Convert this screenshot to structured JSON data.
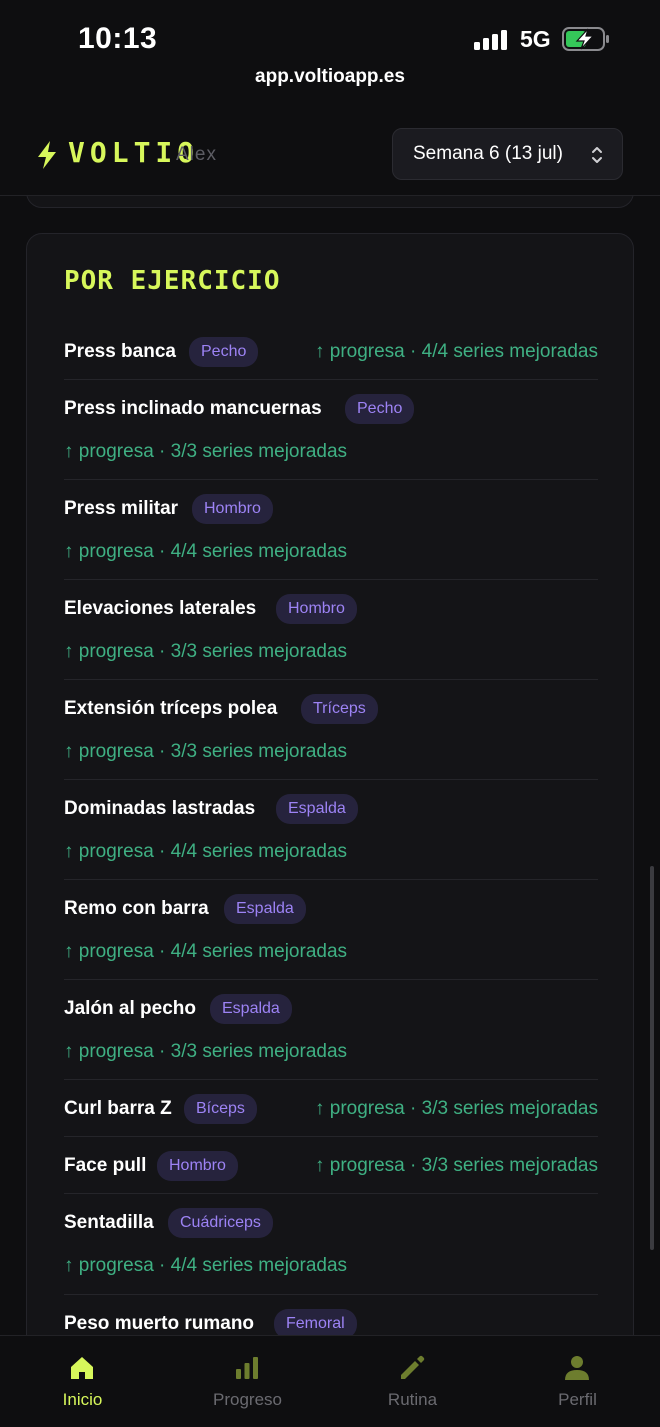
{
  "status_bar": {
    "time": "10:13",
    "network": "5G"
  },
  "browser": {
    "url": "app.voltioapp.es"
  },
  "header": {
    "brand": "VOLTIO",
    "user": "Alex",
    "week_select": "Semana 6 (13 jul)"
  },
  "section": {
    "title": "POR EJERCICIO",
    "exercises": [
      {
        "name": "Press banca",
        "muscle": "Pecho",
        "progress": "↑ progresa · 4/4 series mejoradas"
      },
      {
        "name": "Press inclinado mancuernas",
        "muscle": "Pecho",
        "progress": "↑ progresa · 3/3 series mejoradas"
      },
      {
        "name": "Press militar",
        "muscle": "Hombro",
        "progress": "↑ progresa · 4/4 series mejoradas"
      },
      {
        "name": "Elevaciones laterales",
        "muscle": "Hombro",
        "progress": "↑ progresa · 3/3 series mejoradas"
      },
      {
        "name": "Extensión tríceps polea",
        "muscle": "Tríceps",
        "progress": "↑ progresa · 3/3 series mejoradas"
      },
      {
        "name": "Dominadas lastradas",
        "muscle": "Espalda",
        "progress": "↑ progresa · 4/4 series mejoradas"
      },
      {
        "name": "Remo con barra",
        "muscle": "Espalda",
        "progress": "↑ progresa · 4/4 series mejoradas"
      },
      {
        "name": "Jalón al pecho",
        "muscle": "Espalda",
        "progress": "↑ progresa · 3/3 series mejoradas"
      },
      {
        "name": "Curl barra Z",
        "muscle": "Bíceps",
        "progress": "↑ progresa · 3/3 series mejoradas"
      },
      {
        "name": "Face pull",
        "muscle": "Hombro",
        "progress": "↑ progresa · 3/3 series mejoradas"
      },
      {
        "name": "Sentadilla",
        "muscle": "Cuádriceps",
        "progress": "↑ progresa · 4/4 series mejoradas"
      },
      {
        "name": "Peso muerto rumano",
        "muscle": "Femoral",
        "progress": ""
      }
    ]
  },
  "tabs": [
    {
      "label": "Inicio",
      "icon": "home-icon",
      "active": true
    },
    {
      "label": "Progreso",
      "icon": "bar-chart-icon",
      "active": false
    },
    {
      "label": "Rutina",
      "icon": "pencil-icon",
      "active": false
    },
    {
      "label": "Perfil",
      "icon": "person-icon",
      "active": false
    }
  ],
  "colors": {
    "accent": "#d7f75b",
    "progress_green": "#3fb083",
    "badge_text": "#9d83f5",
    "badge_bg": "#26233d",
    "background": "#0e0e10",
    "card": "#141417"
  }
}
